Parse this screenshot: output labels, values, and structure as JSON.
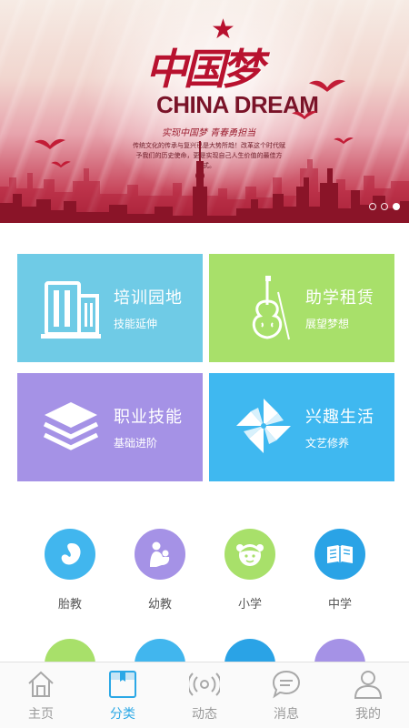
{
  "banner": {
    "cn_title": "中国梦",
    "en_title": "CHINA DREAM",
    "slogan": "实现中国梦  青春勇担当",
    "subtext": "传统文化的传承与复兴已是大势所趋！改革这个时代赋予我们的历史使命，更是实现自己人生价值的最佳方式。",
    "carousel_count": 3,
    "carousel_active": 3
  },
  "tiles": [
    {
      "title": "培训园地",
      "subtitle": "技能延伸",
      "color": "#6fcbe6",
      "icon": "building-icon"
    },
    {
      "title": "助学租赁",
      "subtitle": "展望梦想",
      "color": "#a8e06a",
      "icon": "violin-icon"
    },
    {
      "title": "职业技能",
      "subtitle": "基础进阶",
      "color": "#a592e6",
      "icon": "layers-icon"
    },
    {
      "title": "兴趣生活",
      "subtitle": "文艺修养",
      "color": "#3fb8f0",
      "icon": "pinwheel-icon"
    }
  ],
  "categories": [
    {
      "label": "胎教",
      "color": "#41b6ee",
      "icon": "fetus-icon"
    },
    {
      "label": "幼教",
      "color": "#a592e6",
      "icon": "mother-child-icon"
    },
    {
      "label": "小学",
      "color": "#a8e06a",
      "icon": "girl-face-icon"
    },
    {
      "label": "中学",
      "color": "#2aa3e6",
      "icon": "open-book-icon"
    }
  ],
  "partial_categories": [
    {
      "color": "#a8e06a"
    },
    {
      "color": "#41b6ee"
    },
    {
      "color": "#2aa3e6"
    },
    {
      "color": "#a592e6"
    }
  ],
  "bottom_nav": [
    {
      "label": "主页",
      "icon": "home-icon",
      "active": false
    },
    {
      "label": "分类",
      "icon": "category-icon",
      "active": true
    },
    {
      "label": "动态",
      "icon": "broadcast-icon",
      "active": false
    },
    {
      "label": "消息",
      "icon": "message-icon",
      "active": false
    },
    {
      "label": "我的",
      "icon": "user-icon",
      "active": false
    }
  ],
  "colors": {
    "accent": "#2ba8e6",
    "nav_inactive": "#9a9a9a"
  }
}
